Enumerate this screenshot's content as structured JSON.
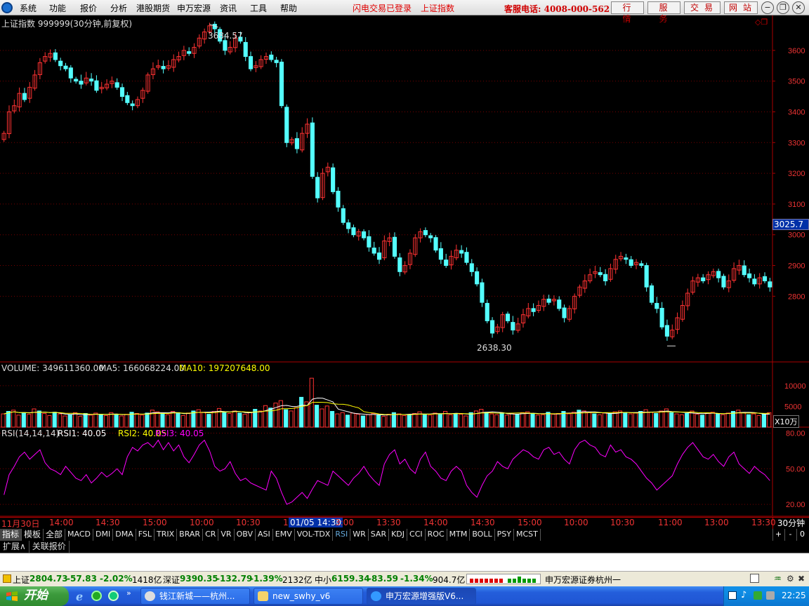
{
  "menubar": {
    "items": [
      "系统",
      "功能",
      "报价",
      "分析",
      "港股期货",
      "申万宏源",
      "资讯",
      "工具",
      "帮助"
    ],
    "status_login": "闪电交易已登录",
    "status_index": "上证指数",
    "hotline": "客服电话: 4008-000-562",
    "buttons": [
      "行情",
      "服务",
      "交易",
      "网站"
    ]
  },
  "chart_header": {
    "title": "上证指数 999999(30分钟,前复权)",
    "high_label": "3684.57",
    "low_label": "2638.30",
    "current_price": "3025.7"
  },
  "volume_header": {
    "volume": "VOLUME: 349611360.00",
    "ma5": "MA5: 166068224.00",
    "ma10": "MA10: 197207648.00",
    "unit": "X10万"
  },
  "rsi_header": {
    "name": "RSI(14,14,14)",
    "rsi1": "RSI1: 40.05",
    "rsi2": "RSI2: 40.05",
    "rsi3": "RSI3: 40.05"
  },
  "price_axis": [
    "3600",
    "3500",
    "3400",
    "3300",
    "3200",
    "3100",
    "3000",
    "2900",
    "2800"
  ],
  "volume_axis": [
    "10000",
    "5000"
  ],
  "rsi_axis": [
    "80.00",
    "50.00",
    "20.00"
  ],
  "time_axis": [
    "11月30日",
    "14:00",
    "14:30",
    "15:00",
    "10:00",
    "10:30",
    "11",
    "01/05 14:30",
    "3:00",
    "13:30",
    "14:00",
    "14:30",
    "15:00",
    "10:00",
    "10:30",
    "11:00",
    "13:00",
    "13:30"
  ],
  "period": "30分钟",
  "indicator_tabs": [
    "指标",
    "模板",
    "全部",
    "MACD",
    "DMI",
    "DMA",
    "FSL",
    "TRIX",
    "BRAR",
    "CR",
    "VR",
    "OBV",
    "ASI",
    "EMV",
    "VOL-TDX",
    "RSI",
    "WR",
    "SAR",
    "KDJ",
    "CCI",
    "ROC",
    "MTM",
    "BOLL",
    "PSY",
    "MCST"
  ],
  "active_tab": "RSI",
  "sub_tabs": [
    "扩展∧",
    "关联报价"
  ],
  "statusbar": {
    "sh_name": "上证",
    "sh_val": "2804.73",
    "sh_chg": "-57.83",
    "sh_pct": "-2.02%",
    "sh_amt": "1418亿",
    "sz_name": "深证",
    "sz_val": "9390.35",
    "sz_chg": "-132.79",
    "sz_pct": "-1.39%",
    "sz_amt": "2132亿",
    "zx_name": "中小",
    "zx_val": "6159.34",
    "zx_chg": "-83.59",
    "zx_pct": "-1.34%",
    "zx_amt": "904.7亿",
    "broker": "申万宏源证券杭州一"
  },
  "taskbar": {
    "start": "开始",
    "tasks": [
      "钱江新城——杭州...",
      "new_swhy_v6",
      "申万宏源增强版V6..."
    ],
    "clock": "22:25"
  },
  "chart_data": [
    {
      "type": "candlestick",
      "title": "上证指数 999999(30分钟,前复权)",
      "ylim": [
        2600,
        3700
      ],
      "annotations": [
        {
          "label": "3684.57",
          "kind": "high"
        },
        {
          "label": "2638.30",
          "kind": "low"
        }
      ],
      "close": [
        3330,
        3400,
        3420,
        3460,
        3440,
        3480,
        3520,
        3560,
        3580,
        3590,
        3570,
        3550,
        3540,
        3510,
        3500,
        3490,
        3510,
        3500,
        3470,
        3480,
        3490,
        3500,
        3480,
        3450,
        3430,
        3420,
        3440,
        3470,
        3520,
        3540,
        3550,
        3540,
        3550,
        3570,
        3580,
        3600,
        3590,
        3610,
        3640,
        3660,
        3680,
        3670,
        3630,
        3600,
        3610,
        3640,
        3630,
        3580,
        3540,
        3550,
        3570,
        3580,
        3570,
        3560,
        3420,
        3300,
        3310,
        3280,
        3330,
        3360,
        3190,
        3120,
        3200,
        3220,
        3140,
        3090,
        3040,
        3020,
        3000,
        3010,
        2990,
        2960,
        2940,
        2920,
        2980,
        2990,
        2930,
        2880,
        2900,
        2940,
        2990,
        3010,
        3000,
        2990,
        2950,
        2920,
        2900,
        2930,
        2950,
        2940,
        2910,
        2880,
        2840,
        2780,
        2720,
        2680,
        2700,
        2740,
        2720,
        2690,
        2710,
        2740,
        2760,
        2750,
        2770,
        2790,
        2780,
        2790,
        2760,
        2730,
        2760,
        2800,
        2830,
        2850,
        2870,
        2880,
        2870,
        2850,
        2890,
        2920,
        2930,
        2920,
        2900,
        2910,
        2900,
        2830,
        2780,
        2760,
        2700,
        2670,
        2690,
        2730,
        2770,
        2810,
        2850,
        2860,
        2850,
        2870,
        2880,
        2860,
        2830,
        2850,
        2890,
        2900,
        2870,
        2860,
        2840,
        2860,
        2850,
        2830
      ]
    },
    {
      "type": "bar",
      "title": "VOLUME",
      "ylabel": "X10万",
      "ylim": [
        0,
        12000
      ],
      "values": [
        3200,
        3800,
        4100,
        2900,
        3500,
        3100,
        4400,
        3900,
        3300,
        2800,
        3600,
        3200,
        2700,
        3000,
        3500,
        2600,
        3300,
        2900,
        3400,
        3100,
        2800,
        3500,
        3000,
        2700,
        3100,
        3600,
        3300,
        2900,
        3400,
        4100,
        3700,
        3200,
        3000,
        3800,
        3500,
        2800,
        3400,
        3900,
        4200,
        3600,
        3100,
        3800,
        4500,
        3700,
        3300,
        3900,
        3400,
        3100,
        3600,
        4300,
        3900,
        5200,
        4600,
        5800,
        6400,
        4200,
        3900,
        4700,
        7200,
        6100,
        11800,
        5300,
        4400,
        5100,
        3800,
        3200,
        3500,
        2900,
        3400,
        3100,
        2700,
        3000,
        3300,
        2900,
        2600,
        3100,
        3500,
        3200,
        2800,
        3000,
        3300,
        3700,
        3100,
        2900,
        3400,
        3200,
        3800,
        3000,
        3300,
        3100,
        2700,
        3500,
        3900,
        4300,
        3600,
        3200,
        3000,
        3400,
        2900,
        3300,
        3100,
        3500,
        3700,
        3200,
        2900,
        3000,
        3600,
        3100,
        3300,
        3800,
        3200,
        3600,
        4100,
        3900,
        3500,
        3200,
        3000,
        3400,
        3300,
        3700,
        3900,
        3500,
        3200,
        3400,
        3800,
        4200,
        3600,
        3300,
        3900,
        4400,
        3500,
        3200,
        3000,
        3300,
        3900,
        3100,
        2900,
        3400,
        3600,
        3200,
        3000,
        3400,
        3800,
        4100,
        3500,
        3000,
        3200,
        2800,
        3100,
        3500
      ]
    },
    {
      "type": "line",
      "title": "RSI(14,14,14)",
      "ylim": [
        10,
        85
      ],
      "series": [
        {
          "name": "RSI1",
          "values": [
            28,
            45,
            52,
            60,
            64,
            58,
            62,
            66,
            55,
            50,
            48,
            45,
            52,
            47,
            42,
            40,
            45,
            38,
            42,
            47,
            43,
            46,
            50,
            45,
            60,
            68,
            65,
            70,
            72,
            68,
            74,
            66,
            72,
            65,
            70,
            60,
            55,
            62,
            70,
            74,
            65,
            52,
            48,
            50,
            56,
            46,
            40,
            42,
            38,
            36,
            34,
            32,
            48,
            42,
            30,
            20,
            22,
            26,
            30,
            25,
            33,
            40,
            38,
            36,
            48,
            44,
            40,
            36,
            42,
            46,
            52,
            45,
            40,
            36,
            54,
            62,
            66,
            54,
            58,
            50,
            46,
            58,
            64,
            52,
            48,
            42,
            40,
            48,
            52,
            48,
            36,
            30,
            26,
            36,
            44,
            48,
            56,
            52,
            50,
            58,
            62,
            66,
            64,
            60,
            58,
            66,
            68,
            62,
            64,
            58,
            54,
            66,
            72,
            74,
            70,
            68,
            62,
            60,
            70,
            64,
            66,
            60,
            58,
            54,
            48,
            42,
            38,
            32,
            36,
            40,
            44,
            54,
            62,
            68,
            72,
            66,
            60,
            58,
            62,
            56,
            52,
            60,
            64,
            54,
            50,
            46,
            52,
            48,
            45,
            40
          ]
        }
      ]
    }
  ]
}
